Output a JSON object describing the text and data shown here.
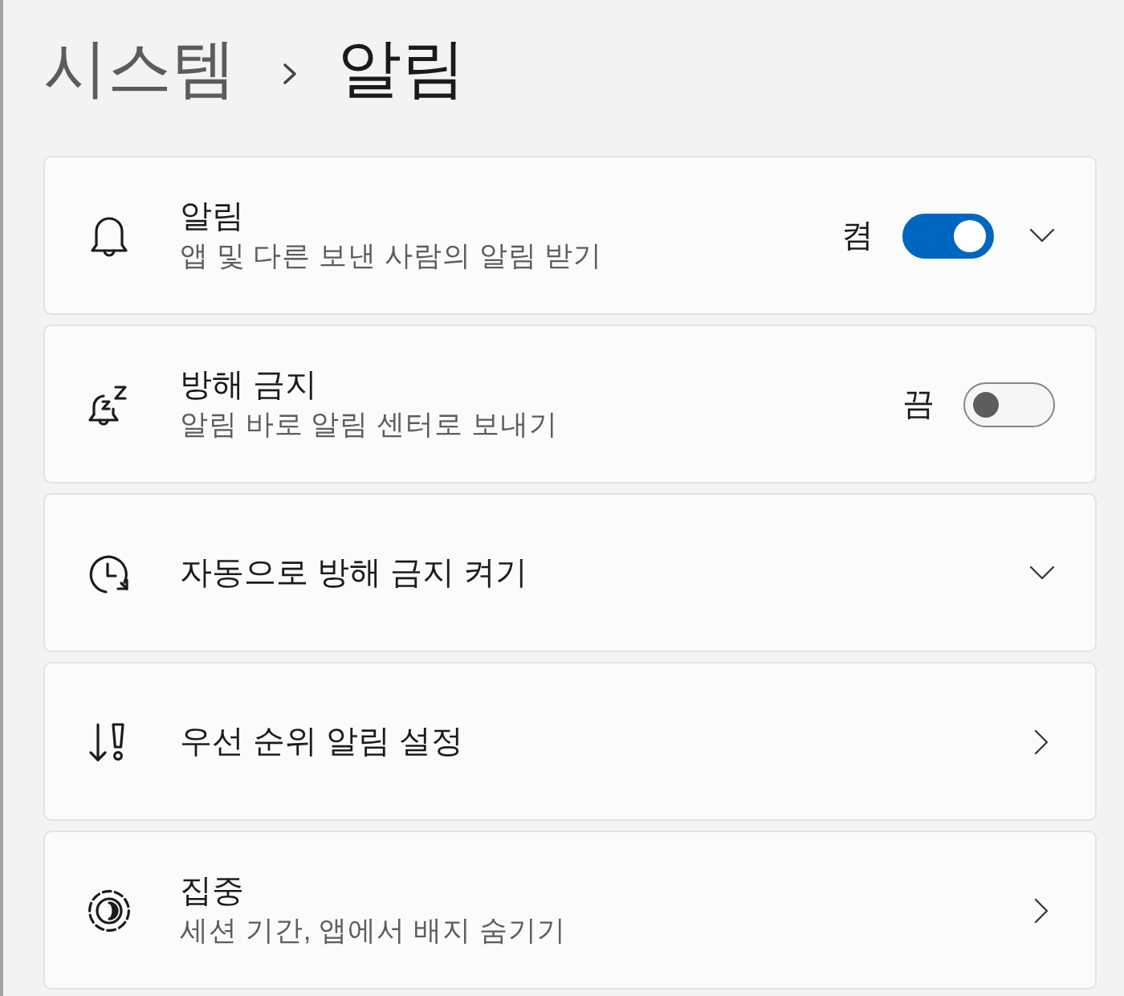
{
  "breadcrumb": {
    "parent": "시스템",
    "current": "알림"
  },
  "rows": [
    {
      "title": "알림",
      "subtitle": "앱 및 다른 보낸 사람의 알림 받기",
      "toggle": {
        "on": true,
        "label": "켬"
      },
      "expander": {
        "expanded": false
      }
    },
    {
      "title": "방해 금지",
      "subtitle": "알림 바로 알림 센터로 보내기",
      "toggle": {
        "on": false,
        "label": "끔"
      }
    },
    {
      "title": "자동으로 방해 금지 켜기",
      "expander": {
        "expanded": false
      }
    },
    {
      "title": "우선 순위 알림 설정",
      "link": true
    },
    {
      "title": "집중",
      "subtitle": "세션 기간, 앱에서 배지 숨기기",
      "link": true
    }
  ]
}
